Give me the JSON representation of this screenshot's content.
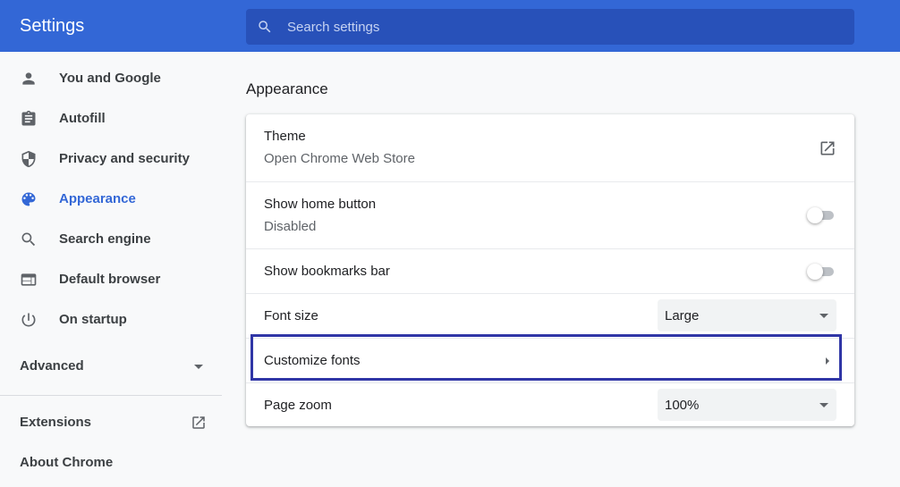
{
  "header": {
    "title": "Settings",
    "search_placeholder": "Search settings",
    "search_icon": "search-icon"
  },
  "sidebar": {
    "items": [
      {
        "label": "You and Google",
        "icon": "person-icon"
      },
      {
        "label": "Autofill",
        "icon": "clipboard-icon"
      },
      {
        "label": "Privacy and security",
        "icon": "shield-icon"
      },
      {
        "label": "Appearance",
        "icon": "palette-icon",
        "active": true
      },
      {
        "label": "Search engine",
        "icon": "search-icon"
      },
      {
        "label": "Default browser",
        "icon": "browser-window-icon"
      },
      {
        "label": "On startup",
        "icon": "power-icon"
      }
    ],
    "advanced_label": "Advanced",
    "extensions_label": "Extensions",
    "about_label": "About Chrome"
  },
  "appearance": {
    "section_title": "Appearance",
    "theme": {
      "title": "Theme",
      "subtitle": "Open Chrome Web Store"
    },
    "home_button": {
      "title": "Show home button",
      "subtitle": "Disabled",
      "enabled": false
    },
    "bookmarks_bar": {
      "title": "Show bookmarks bar",
      "enabled": false
    },
    "font_size": {
      "title": "Font size",
      "value": "Large"
    },
    "customize_fonts": {
      "title": "Customize fonts"
    },
    "page_zoom": {
      "title": "Page zoom",
      "value": "100%"
    }
  },
  "colors": {
    "accent": "#3367d6",
    "header_bg": "#3367d6",
    "search_bg": "#2851b9",
    "highlight_border": "#3036a6"
  }
}
